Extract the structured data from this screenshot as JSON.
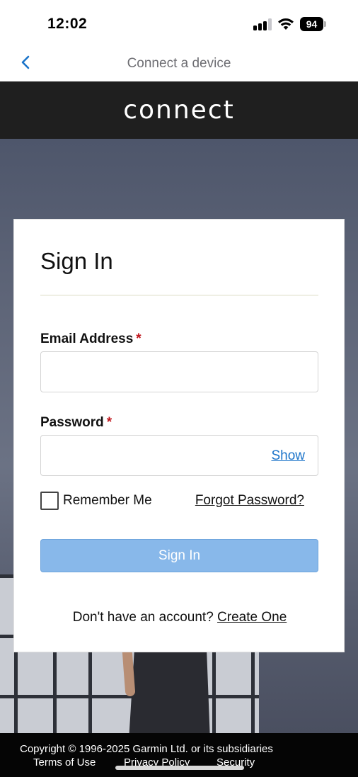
{
  "status_bar": {
    "time": "12:02",
    "battery_level": "94",
    "icons": [
      "cellular-signal-icon",
      "wifi-icon",
      "battery-icon"
    ]
  },
  "nav_bar": {
    "title": "Connect a device",
    "back_icon": "chevron-left-icon",
    "accent_color": "#1a73c9"
  },
  "brand": {
    "logo_text": "connect",
    "bar_color": "#1f1f1f"
  },
  "signin_form": {
    "title": "Sign In",
    "email": {
      "label": "Email Address",
      "required_mark": "*",
      "value": ""
    },
    "password": {
      "label": "Password",
      "required_mark": "*",
      "value": "",
      "show_label": "Show"
    },
    "remember_me": {
      "label": "Remember Me",
      "checked": false
    },
    "forgot_password": "Forgot Password?",
    "submit_label": "Sign In",
    "submit_color": "#88b8ea",
    "signup_prompt": "Don't have an account?",
    "signup_link": "Create One"
  },
  "footer": {
    "copyright": "Copyright © 1996-2025 Garmin Ltd. or its subsidiaries",
    "links": [
      "Terms of Use",
      "Privacy Policy",
      "Security"
    ]
  }
}
